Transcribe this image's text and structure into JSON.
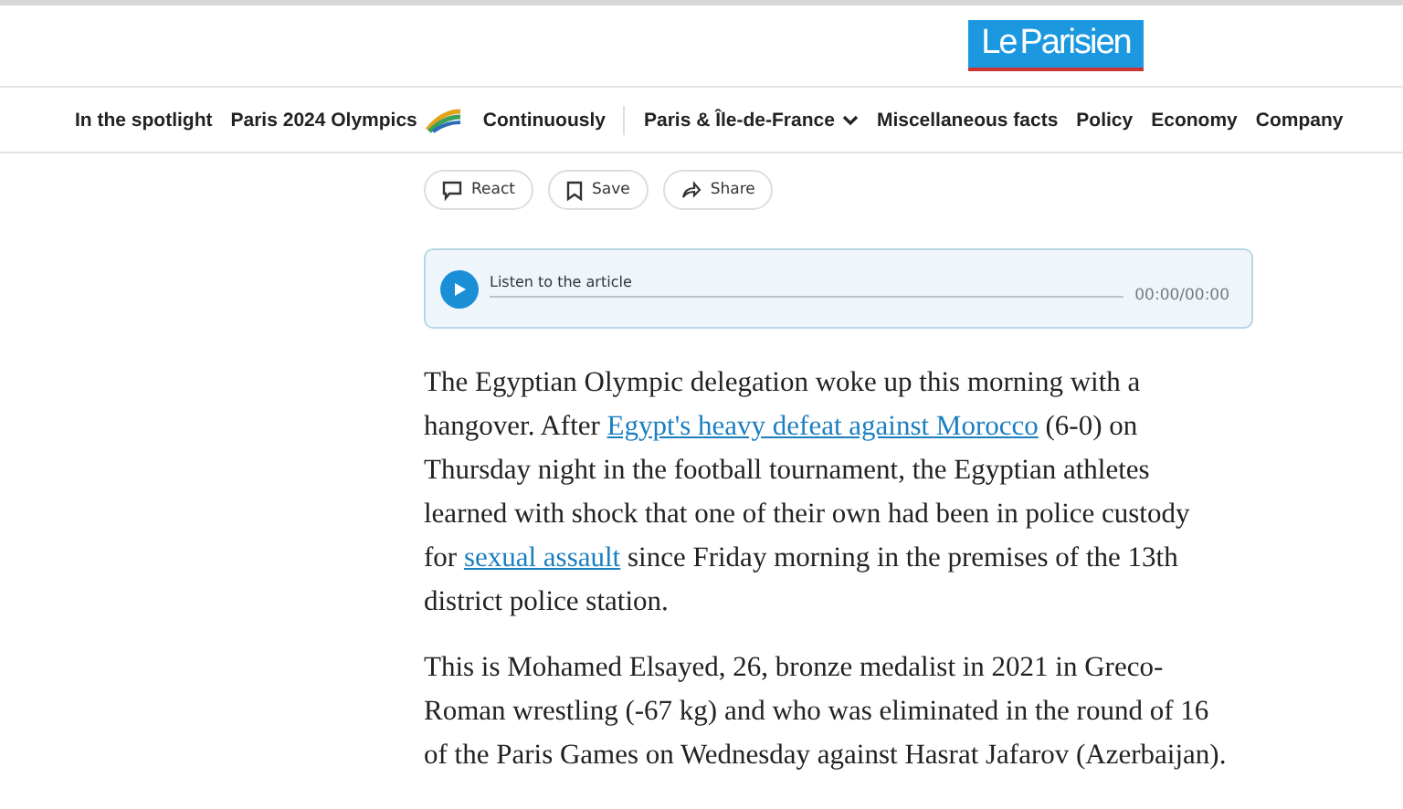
{
  "logo": {
    "first": "Le",
    "second": "Parisien"
  },
  "nav": [
    {
      "label": "In the spotlight",
      "kind": "plain"
    },
    {
      "label": "Paris 2024 Olympics",
      "kind": "olympics"
    },
    {
      "label": "Continuously",
      "kind": "plain"
    },
    {
      "label": "Paris & Île-de-France",
      "kind": "dropdown"
    },
    {
      "label": "Miscellaneous facts",
      "kind": "plain"
    },
    {
      "label": "Policy",
      "kind": "plain"
    },
    {
      "label": "Economy",
      "kind": "plain"
    },
    {
      "label": "Company",
      "kind": "plain"
    }
  ],
  "actions": [
    {
      "label": "React",
      "kind": "react"
    },
    {
      "label": "Save",
      "kind": "save"
    },
    {
      "label": "Share",
      "kind": "share"
    }
  ],
  "audio": {
    "label": "Listen to the article",
    "time": "00:00/00:00",
    "level": 0
  },
  "paragraphs": [
    [
      {
        "text": "The Egyptian Olympic delegation woke up this morning with a hangover. After ",
        "link": false
      },
      {
        "text": "Egypt's heavy defeat against Morocco",
        "link": true
      },
      {
        "text": " (6-0) on Thursday night in the football tournament, the Egyptian athletes learned with shock that one of their own had been in police custody for ",
        "link": false
      },
      {
        "text": "sexual assault",
        "link": true
      },
      {
        "text": " since Friday morning in the premises of the 13th district police station.",
        "link": false
      }
    ],
    [
      {
        "text": "This is Mohamed Elsayed, 26, bronze medalist in 2021 in Greco-Roman wrestling (-67 kg) and who was eliminated in the round of 16 of the Paris Games on Wednesday against Hasrat Jafarov (Azerbaijan).",
        "link": false
      }
    ]
  ]
}
